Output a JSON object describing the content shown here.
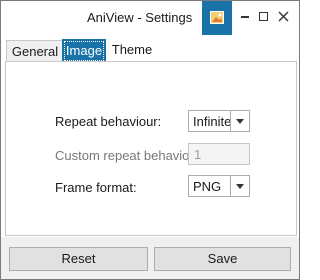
{
  "window": {
    "title": "AniView - Settings",
    "accent_color": "#1a73a8",
    "app_icon": "image-icon",
    "caption_buttons": [
      "minimize-icon",
      "maximize-icon",
      "close-icon"
    ]
  },
  "tabs": [
    {
      "label": "General",
      "selected": false
    },
    {
      "label": "Image",
      "selected": true
    },
    {
      "label": "Theme",
      "selected": false
    }
  ],
  "image_settings": {
    "repeat_behaviour_label": "Repeat behaviour:",
    "repeat_behaviour_value": "Infinite",
    "custom_repeat_label": "Custom repeat behavio",
    "custom_repeat_value": "1",
    "frame_format_label": "Frame format:",
    "frame_format_value": "PNG"
  },
  "footer": {
    "reset_label": "Reset",
    "save_label": "Save"
  }
}
